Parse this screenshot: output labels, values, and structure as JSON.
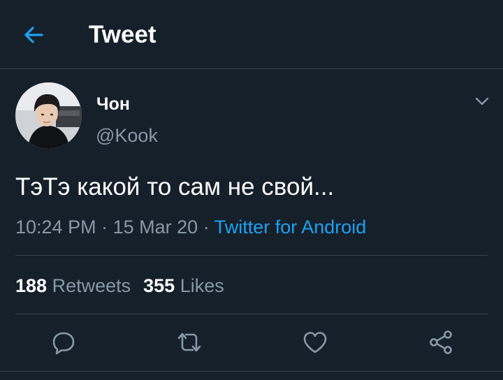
{
  "header": {
    "back_icon": "arrow-left-icon",
    "title": "Tweet"
  },
  "tweet": {
    "author": {
      "display_name": "Чон",
      "handle": "@Kook"
    },
    "text": "ТэТэ какой то сам не свой...",
    "time": "10:24 PM",
    "date": "15 Mar 20",
    "separator": "·",
    "source": "Twitter for Android",
    "stats": {
      "retweets_count": "188",
      "retweets_label": "Retweets",
      "likes_count": "355",
      "likes_label": "Likes"
    }
  },
  "actions": [
    {
      "name": "reply",
      "icon": "reply-icon"
    },
    {
      "name": "retweet",
      "icon": "retweet-icon"
    },
    {
      "name": "like",
      "icon": "heart-icon"
    },
    {
      "name": "share",
      "icon": "share-icon"
    }
  ],
  "colors": {
    "background": "#15202b",
    "accent": "#1da1f2",
    "secondary_text": "#8899a6",
    "divider": "#38444d",
    "primary_text": "#ffffff"
  }
}
